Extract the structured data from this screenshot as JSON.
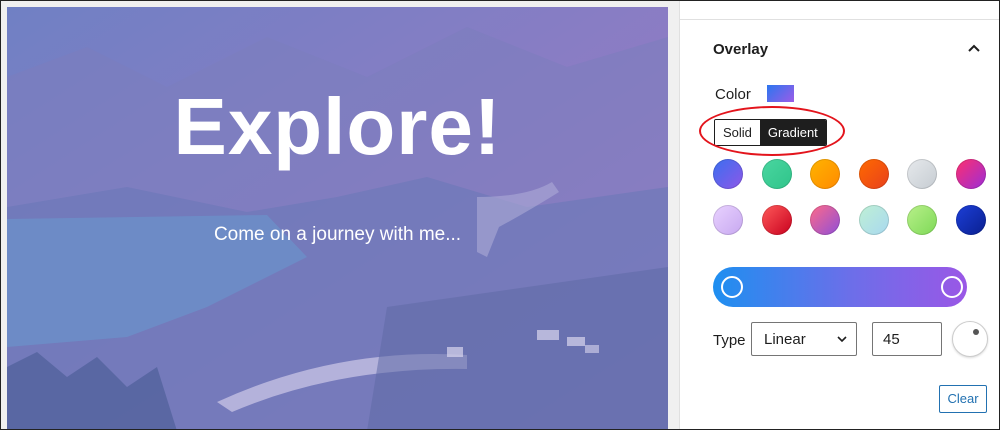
{
  "hero": {
    "title": "Explore!",
    "subtitle": "Come on a journey with me..."
  },
  "overlay_panel": {
    "title": "Overlay",
    "color_label": "Color",
    "toggle": {
      "solid": "Solid",
      "gradient": "Gradient",
      "active": "Gradient"
    },
    "gradient_presets": [
      {
        "name": "preset-1",
        "colors": [
          "#3a6ff0",
          "#8e57e8"
        ]
      },
      {
        "name": "preset-2",
        "colors": [
          "#4ad6a0",
          "#2fc48a"
        ]
      },
      {
        "name": "preset-3",
        "colors": [
          "#ffb400",
          "#ff8a00"
        ]
      },
      {
        "name": "preset-4",
        "colors": [
          "#ff6a00",
          "#e8401c"
        ]
      },
      {
        "name": "preset-5",
        "colors": [
          "#e6e9ec",
          "#c6ccd2"
        ]
      },
      {
        "name": "preset-6",
        "colors": [
          "#ff2f6e",
          "#9b2dd8"
        ]
      },
      {
        "name": "preset-7",
        "colors": [
          "#e9d2ff",
          "#c7a8f0"
        ]
      },
      {
        "name": "preset-8",
        "colors": [
          "#ff5a5a",
          "#c8001e"
        ]
      },
      {
        "name": "preset-9",
        "colors": [
          "#ff6a88",
          "#8f4fd8"
        ]
      },
      {
        "name": "preset-10",
        "colors": [
          "#bff0d4",
          "#a8d8f0"
        ]
      },
      {
        "name": "preset-11",
        "colors": [
          "#b8f08a",
          "#7ed957"
        ]
      },
      {
        "name": "preset-12",
        "colors": [
          "#1c3fd8",
          "#0a1f8f"
        ]
      }
    ],
    "gradient_bar_colors": [
      "#1e8ff0",
      "#9a57e6"
    ],
    "type_label": "Type",
    "type_value": "Linear",
    "angle_value": "45",
    "clear_label": "Clear"
  }
}
